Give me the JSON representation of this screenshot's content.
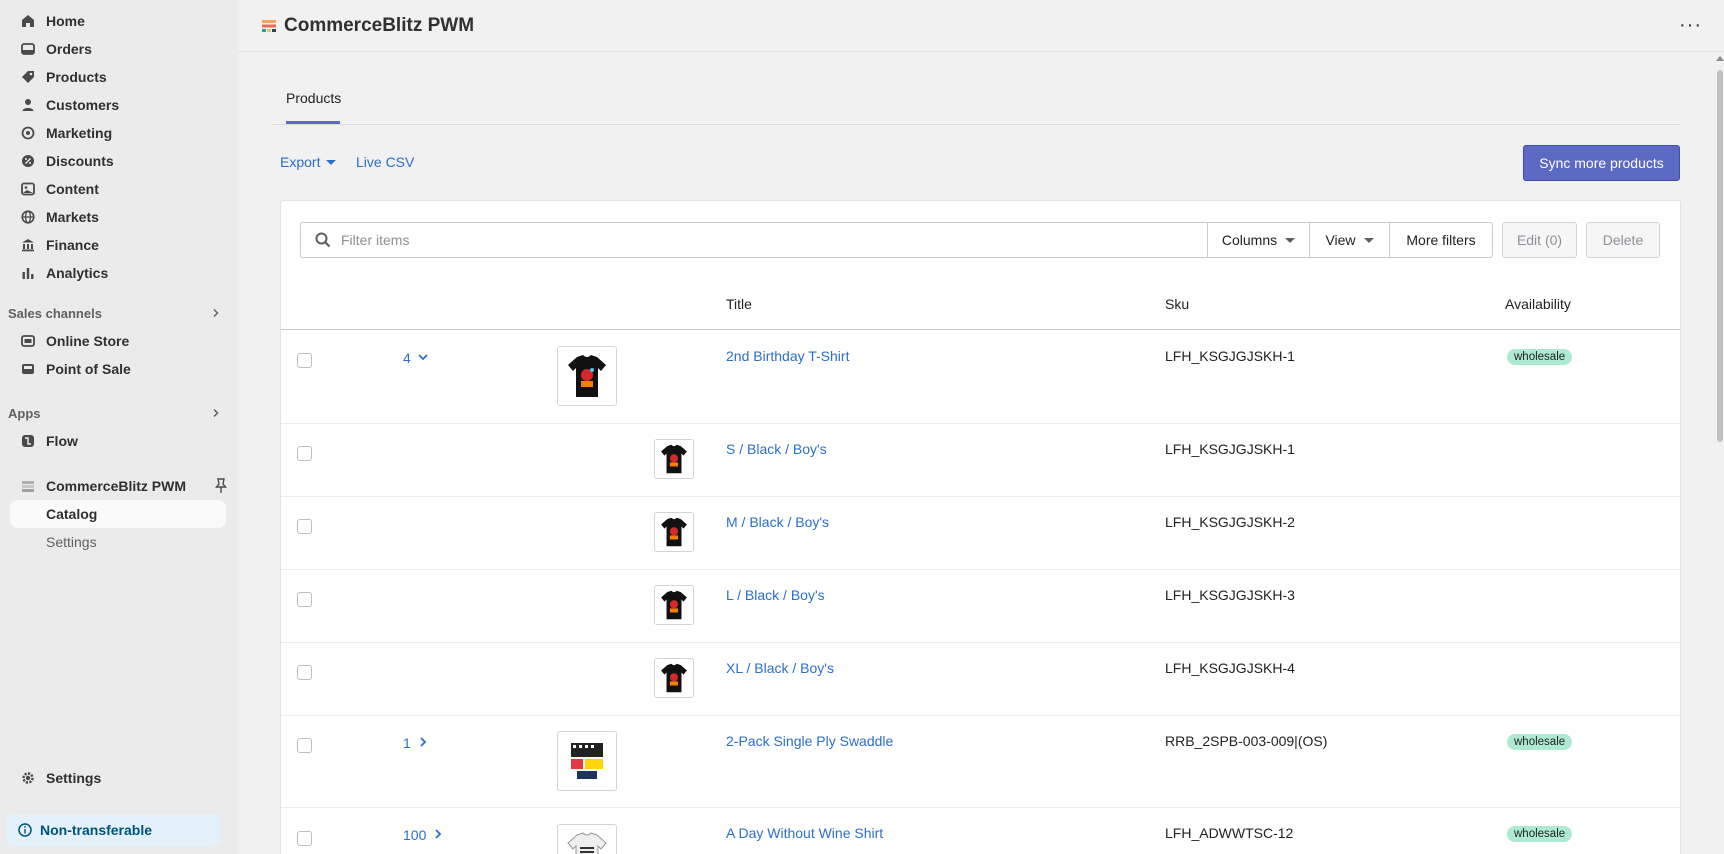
{
  "sidebar": {
    "nav": [
      {
        "label": "Home",
        "icon": "home-icon"
      },
      {
        "label": "Orders",
        "icon": "orders-icon"
      },
      {
        "label": "Products",
        "icon": "tag-icon"
      },
      {
        "label": "Customers",
        "icon": "person-icon"
      },
      {
        "label": "Marketing",
        "icon": "target-icon"
      },
      {
        "label": "Discounts",
        "icon": "discount-icon"
      },
      {
        "label": "Content",
        "icon": "content-icon"
      },
      {
        "label": "Markets",
        "icon": "globe-icon"
      },
      {
        "label": "Finance",
        "icon": "bank-icon"
      },
      {
        "label": "Analytics",
        "icon": "chart-bar-icon"
      }
    ],
    "sales_channels_heading": "Sales channels",
    "sales_channels": [
      {
        "label": "Online Store",
        "icon": "store-icon"
      },
      {
        "label": "Point of Sale",
        "icon": "pos-icon"
      }
    ],
    "apps_heading": "Apps",
    "apps": [
      {
        "label": "Flow",
        "icon": "flow-icon"
      },
      {
        "label": "CommerceBlitz PWM",
        "icon": "app-logo-icon"
      }
    ],
    "app_subnav": [
      {
        "label": "Catalog"
      },
      {
        "label": "Settings"
      }
    ],
    "settings_label": "Settings",
    "non_transferable_label": "Non-transferable"
  },
  "header": {
    "app_title": "CommerceBlitz PWM",
    "more_label": "···"
  },
  "tabs": [
    {
      "label": "Products"
    }
  ],
  "toolbar": {
    "export_label": "Export",
    "live_csv_label": "Live CSV",
    "sync_label": "Sync more products"
  },
  "filters": {
    "search_placeholder": "Filter items",
    "columns_label": "Columns",
    "view_label": "View",
    "more_filters_label": "More filters",
    "edit_label": "Edit (0)",
    "delete_label": "Delete"
  },
  "table": {
    "headers": {
      "title": "Title",
      "sku": "Sku",
      "availability": "Availability"
    },
    "rows": [
      {
        "count": "4",
        "expanded": true,
        "title": "2nd Birthday T-Shirt",
        "sku": "LFH_KSGJGJSKH-1",
        "availability": "wholesale"
      },
      {
        "title": "S / Black / Boy's",
        "sku": "LFH_KSGJGJSKH-1"
      },
      {
        "title": "M / Black / Boy's",
        "sku": "LFH_KSGJGJSKH-2"
      },
      {
        "title": "L / Black / Boy's",
        "sku": "LFH_KSGJGJSKH-3"
      },
      {
        "title": "XL / Black / Boy's",
        "sku": "LFH_KSGJGJSKH-4"
      },
      {
        "count": "1",
        "expanded": false,
        "title": "2-Pack Single Ply Swaddle",
        "sku": "RRB_2SPB-003-009|(OS)",
        "availability": "wholesale"
      },
      {
        "count": "100",
        "expanded": false,
        "title": "A Day Without Wine Shirt",
        "sku": "LFH_ADWWTSC-12",
        "availability": "wholesale"
      }
    ]
  },
  "colors": {
    "accent": "#5c6ac4",
    "link": "#2c6ecb",
    "badge_bg": "#aee9d1",
    "banner_bg": "#e3f1fb"
  }
}
